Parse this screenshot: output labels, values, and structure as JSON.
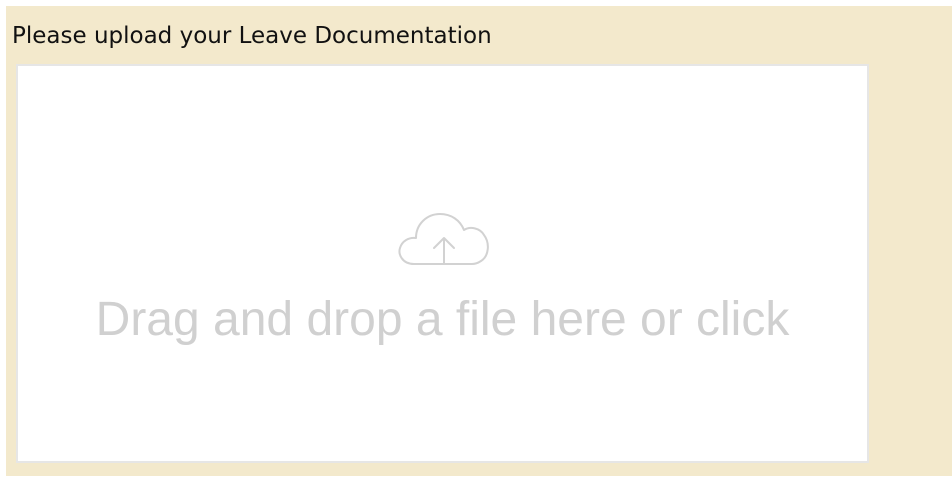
{
  "upload": {
    "label": "Please upload your Leave Documentation",
    "dropzone_text": "Drag and drop a file here or click",
    "icon": "cloud-upload-icon"
  },
  "colors": {
    "panel_background": "#f3e9cc",
    "dropzone_background": "#ffffff",
    "dropzone_border": "#e6e6e6",
    "placeholder_text": "#d0d0d0"
  }
}
